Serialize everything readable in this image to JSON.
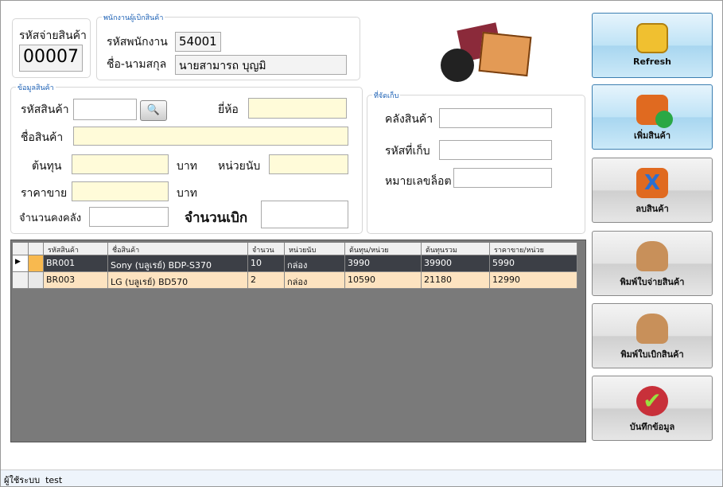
{
  "issue_id": {
    "label": "รหัสจ่ายสินค้า",
    "value": "00007"
  },
  "employee": {
    "group_title": "พนักงานผู้เบิกสินค้า",
    "id_label": "รหัสพนักงาน",
    "id_value": "54001",
    "name_label": "ชื่อ-นามสกุล",
    "name_value": "นายสามารถ บุญมิ"
  },
  "product": {
    "group_title": "ข้อมูลสินค้า",
    "code_label": "รหัสสินค้า",
    "code_value": "",
    "brand_label": "ยี่ห้อ",
    "brand_value": "",
    "name_label": "ชื่อสินค้า",
    "name_value": "",
    "cost_label": "ต้นทุน",
    "cost_value": "",
    "baht1": "บาท",
    "unit_label": "หน่วยนับ",
    "unit_value": "",
    "price_label": "ราคาขาย",
    "price_value": "",
    "baht2": "บาท",
    "stock_label": "จำนวนคงคลัง",
    "stock_value": "",
    "withdraw_label": "จำนวนเบิก",
    "withdraw_value": ""
  },
  "storage": {
    "group_title": "ที่จัดเก็บ",
    "warehouse_label": "คลังสินค้า",
    "warehouse_value": "",
    "location_label": "รหัสที่เก็บ",
    "location_value": "",
    "lot_label": "หมายเลขล็อต",
    "lot_value": ""
  },
  "grid": {
    "columns": [
      "รหัสสินค้า",
      "ชื่อสินค้า",
      "จำนวน",
      "หน่วยนับ",
      "ต้นทุน/หน่วย",
      "ต้นทุนรวม",
      "ราคาขาย/หน่วย"
    ],
    "rows": [
      [
        "BR001",
        "Sony (บลูเรย์) BDP-S370",
        "10",
        "กล่อง",
        "3990",
        "39900",
        "5990"
      ],
      [
        "BR003",
        "LG (บลูเรย์) BD570",
        "2",
        "กล่อง",
        "10590",
        "21180",
        "12990"
      ]
    ]
  },
  "buttons": [
    {
      "label": "Refresh",
      "icon": "radiation-folder-icon"
    },
    {
      "label": "เพิ่มสินค้า",
      "icon": "add-folder-icon"
    },
    {
      "label": "ลบสินค้า",
      "icon": "delete-folder-icon"
    },
    {
      "label": "พิมพ์ใบจ่ายสินค้า",
      "icon": "print-bag-icon"
    },
    {
      "label": "พิมพ์ใบเบิกสินค้า",
      "icon": "print-bag-icon"
    },
    {
      "label": "บันทึกข้อมูล",
      "icon": "check-icon"
    }
  ],
  "status": {
    "user_label": "ผู้ใช้ระบบ",
    "user_value": "test"
  }
}
